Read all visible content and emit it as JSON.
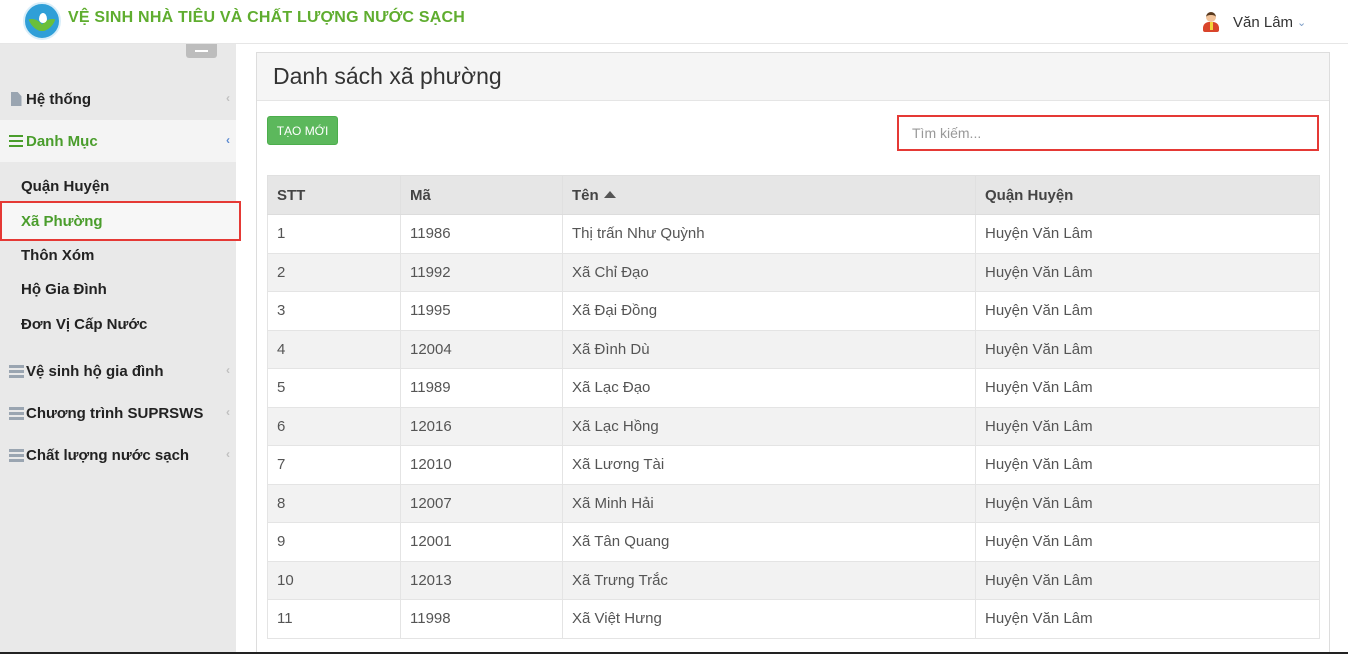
{
  "header": {
    "app_title": "VỆ SINH NHÀ TIÊU VÀ CHẤT LƯỢNG NƯỚC SẠCH",
    "user_name": "Văn Lâm",
    "user_caret": "⌄",
    "brand_color": "#5fad2f"
  },
  "sidebar": {
    "items": [
      {
        "label": "Hệ thống",
        "icon": "document-icon",
        "chevron": "‹"
      },
      {
        "label": "Danh Mục",
        "icon": "list-icon",
        "chevron": "‹"
      },
      {
        "label": "Vệ sinh hộ gia đình",
        "icon": "server-icon",
        "chevron": "‹"
      },
      {
        "label": "Chương trình SUPRSWS",
        "icon": "server-icon",
        "chevron": "‹"
      },
      {
        "label": "Chất lượng nước sạch",
        "icon": "server-icon",
        "chevron": "‹"
      }
    ],
    "sub_items": [
      {
        "label": "Quận Huyện"
      },
      {
        "label": "Xã Phường"
      },
      {
        "label": "Thôn Xóm"
      },
      {
        "label": "Hộ Gia Đình"
      },
      {
        "label": "Đơn Vị Cấp Nước"
      }
    ]
  },
  "main": {
    "title": "Danh sách xã phường",
    "create_button": "TẠO MỚI",
    "search_placeholder": "Tìm kiếm...",
    "table": {
      "headers": [
        "STT",
        "Mã",
        "Tên",
        "Quận Huyện"
      ],
      "sorted_column": "Tên",
      "sort_direction": "ascending",
      "rows": [
        [
          "1",
          "11986",
          "Thị trấn Như Quỳnh",
          "Huyện Văn Lâm"
        ],
        [
          "2",
          "11992",
          "Xã Chỉ Đạo",
          "Huyện Văn Lâm"
        ],
        [
          "3",
          "11995",
          "Xã Đại Đồng",
          "Huyện Văn Lâm"
        ],
        [
          "4",
          "12004",
          "Xã Đình Dù",
          "Huyện Văn Lâm"
        ],
        [
          "5",
          "11989",
          "Xã Lạc Đạo",
          "Huyện Văn Lâm"
        ],
        [
          "6",
          "12016",
          "Xã Lạc Hồng",
          "Huyện Văn Lâm"
        ],
        [
          "7",
          "12010",
          "Xã Lương Tài",
          "Huyện Văn Lâm"
        ],
        [
          "8",
          "12007",
          "Xã Minh Hải",
          "Huyện Văn Lâm"
        ],
        [
          "9",
          "12001",
          "Xã Tân Quang",
          "Huyện Văn Lâm"
        ],
        [
          "10",
          "12013",
          "Xã Trưng Trắc",
          "Huyện Văn Lâm"
        ],
        [
          "11",
          "11998",
          "Xã Việt Hưng",
          "Huyện Văn Lâm"
        ]
      ]
    }
  }
}
